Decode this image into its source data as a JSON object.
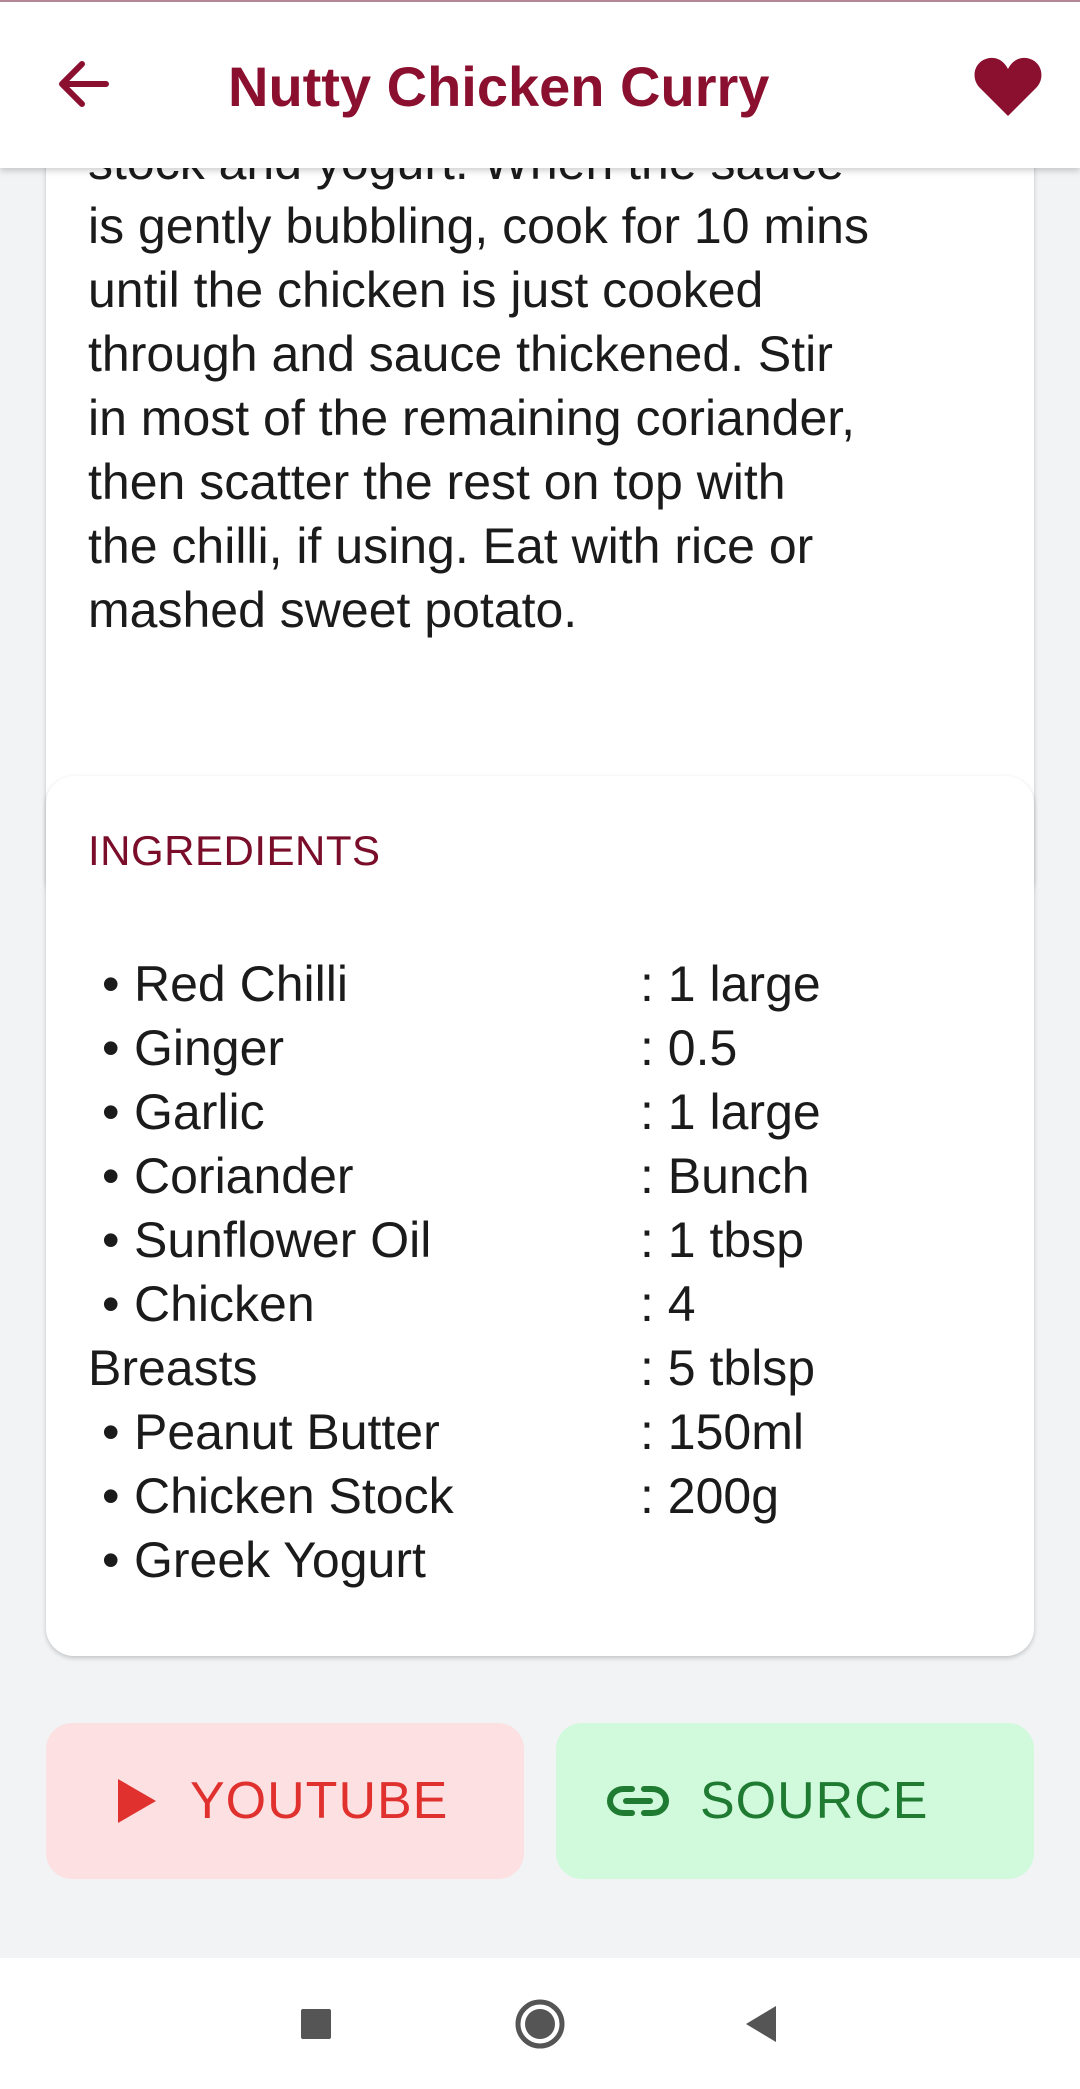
{
  "appbar": {
    "title": "Nutty Chicken Curry",
    "back_icon": "arrow-back-icon",
    "favorite_icon": "heart-icon"
  },
  "method": {
    "lines": [
      "stock and yogurt. When the sauce",
      "is gently bubbling, cook for 10 mins",
      "until the chicken is just cooked",
      "through and sauce thickened. Stir",
      "in most of the remaining coriander,",
      "then scatter the rest on top with",
      "the chilli, if using. Eat with rice or",
      "mashed sweet potato."
    ]
  },
  "ingredients": {
    "heading": "INGREDIENTS",
    "bullet": "•",
    "separator": ": ",
    "rows": [
      {
        "name": "Red Chilli",
        "bulleted": true,
        "qty": "1 large"
      },
      {
        "name": "Ginger",
        "bulleted": true,
        "qty": "0.5"
      },
      {
        "name": "Garlic",
        "bulleted": true,
        "qty": "1 large"
      },
      {
        "name": "Coriander",
        "bulleted": true,
        "qty": "Bunch"
      },
      {
        "name": "Sunflower Oil",
        "bulleted": true,
        "qty": "1 tbsp"
      },
      {
        "name": "Chicken",
        "bulleted": true,
        "qty": "4"
      },
      {
        "name": "Breasts",
        "bulleted": false,
        "qty": "5 tblsp"
      },
      {
        "name": "Peanut Butter",
        "bulleted": true,
        "qty": "150ml"
      },
      {
        "name": "Chicken Stock",
        "bulleted": true,
        "qty": "200g"
      },
      {
        "name": "Greek Yogurt",
        "bulleted": true,
        "qty": ""
      }
    ]
  },
  "actions": {
    "youtube": {
      "label": "YOUTUBE",
      "icon": "play-icon"
    },
    "source": {
      "label": "SOURCE",
      "icon": "link-icon"
    }
  },
  "navbar": {
    "recents_icon": "square-recents-icon",
    "home_icon": "circle-home-icon",
    "back_icon": "triangle-back-icon"
  },
  "colors": {
    "brand": "#8b0f2e",
    "youtube_bg": "#fde0e2",
    "youtube_fg": "#e0312f",
    "source_bg": "#d0fadb",
    "source_fg": "#1f7a32",
    "page_bg": "#f1f3f5"
  }
}
